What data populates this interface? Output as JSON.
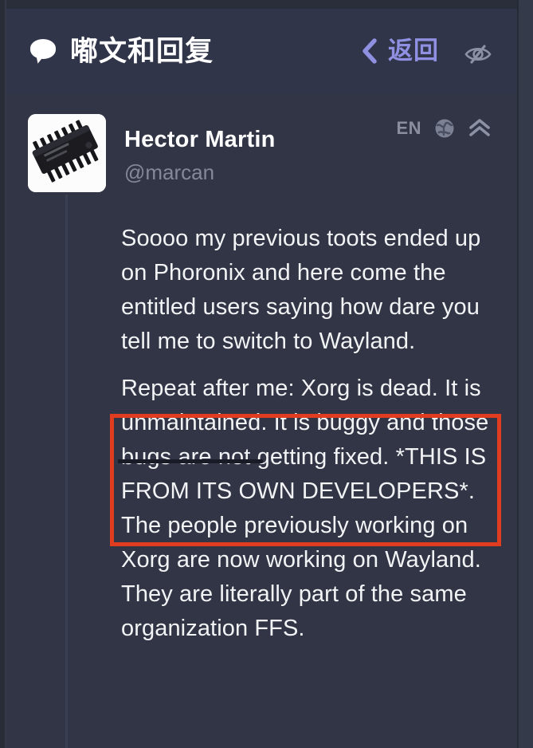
{
  "app": {
    "header": {
      "bubble_icon": "speech-bubble-icon",
      "title": "嘟文和回复",
      "back_label": "返回",
      "back_icon": "chevron-left-icon",
      "visibility_icon": "eye-slash-icon"
    },
    "colors": {
      "background": "#313545",
      "header_background": "#313549",
      "accent_purple": "#8f90e2",
      "muted_text": "#848899",
      "primary_text": "#f2f3f5",
      "annotation_red": "#e03c20",
      "thread_line": "#3a3f52"
    }
  },
  "post": {
    "avatar": "integrated-circuit-chip-photo",
    "display_name": "Hector Martin",
    "handle": "@marcan",
    "language": "EN",
    "globe_icon": "globe-icon",
    "collapse_icon": "chevron-up-double-icon",
    "body": [
      "Soooo my previous toots ended up on Phoronix and here come the entitled users saying how dare you tell me to switch to Wayland.",
      "Repeat after me: Xorg is dead. It is unmaintained. It is buggy and those bugs are not getting fixed. *THIS IS FROM ITS OWN DEVELOPERS*. The people previously working on Xorg are now working on Wayland. They are literally part of the same organization FFS."
    ]
  },
  "annotations": {
    "highlight_box": "red-rectangle-around-xorg-is-dead-passage",
    "underline": "underline-under-repeat-after"
  }
}
